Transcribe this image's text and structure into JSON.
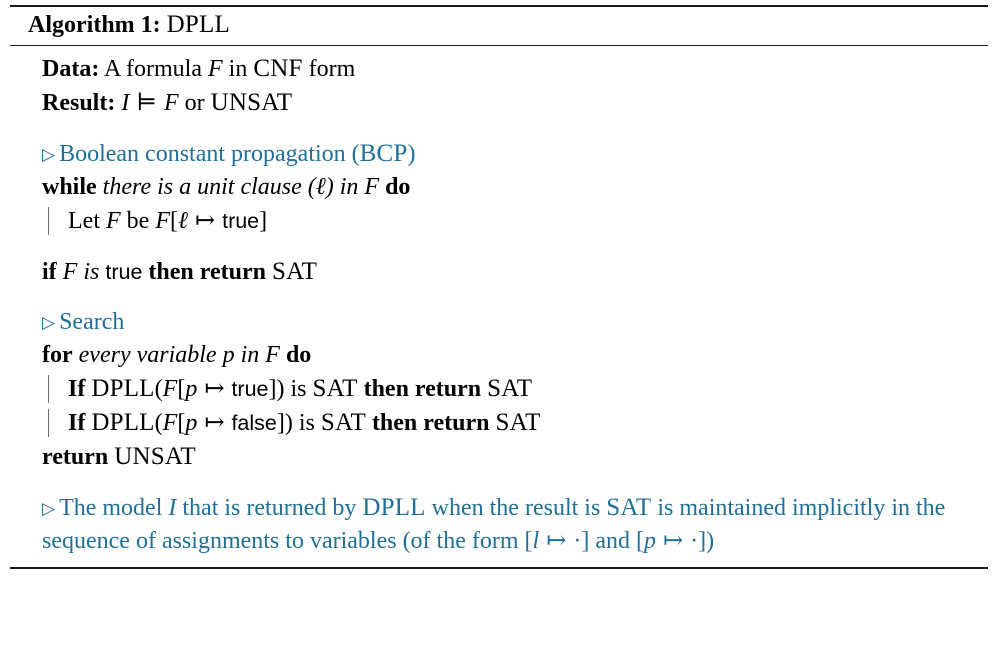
{
  "document": {
    "type": "algorithm-float",
    "caption_label": "Algorithm 1:",
    "caption_name": "DPLL",
    "comment_color": "#1f6f99",
    "text_color": "#000000",
    "rule_color": "#1a1a1a"
  },
  "io": {
    "data_label": "Data:",
    "data_text_a": "A formula",
    "data_var": "F",
    "data_text_b": "in",
    "data_format": "CNF",
    "data_text_c": "form",
    "result_label": "Result:",
    "result_var": "I",
    "result_models": "⊨",
    "result_formula": "F",
    "result_or": "or",
    "result_unsat": "UNSAT"
  },
  "bcp": {
    "comment_marker": "▷",
    "comment_text": "Boolean constant propagation (",
    "comment_abbrev": "BCP",
    "comment_close": ")",
    "while_kw": "while",
    "while_cond_a": "there is a unit clause",
    "while_cond_lit": "(ℓ)",
    "while_cond_b": "in",
    "while_cond_var": "F",
    "do_kw": "do",
    "body_let": "Let",
    "body_var1": "F",
    "body_be": "be",
    "body_var2": "F",
    "body_open": "[",
    "body_lit": "ℓ",
    "body_mapsto": "↦",
    "body_value": "true",
    "body_close": "]"
  },
  "sat_check": {
    "if_kw": "if",
    "if_var": "F",
    "if_is": "is",
    "if_value": "true",
    "then_kw": "then return",
    "result": "SAT"
  },
  "search": {
    "comment_marker": "▷",
    "comment_text": "Search",
    "for_kw": "for",
    "for_cond_a": "every variable",
    "for_var": "p",
    "for_cond_b": "in",
    "for_formula": "F",
    "do_kw": "do",
    "branches": [
      {
        "if_kw": "If",
        "call": "DPLL",
        "open_paren": "(",
        "formula": "F",
        "open_brk": "[",
        "var": "p",
        "mapsto": "↦",
        "value": "true",
        "close_brk": "]",
        "close_paren": ")",
        "is": "is",
        "status": "SAT",
        "then_kw": "then return",
        "result": "SAT"
      },
      {
        "if_kw": "If",
        "call": "DPLL",
        "open_paren": "(",
        "formula": "F",
        "open_brk": "[",
        "var": "p",
        "mapsto": "↦",
        "value": "false",
        "close_brk": "]",
        "close_paren": ")",
        "is": "is",
        "status": "SAT",
        "then_kw": "then return",
        "result": "SAT"
      }
    ],
    "return_kw": "return",
    "return_value": "UNSAT"
  },
  "note": {
    "comment_marker": "▷",
    "t1": "The model",
    "m1": "I",
    "t2": "that is returned by",
    "sc1": "DPLL",
    "t3": "when the result is",
    "sc2": "SAT",
    "t4": "is maintained implicitly in the sequence of assignments to variables (of the form",
    "f1_open": "[",
    "f1_var": "l",
    "f1_mapsto": "↦",
    "f1_dot": "·",
    "f1_close": "]",
    "t5": "and",
    "f2_open": "[",
    "f2_var": "p",
    "f2_mapsto": "↦",
    "f2_dot": "·",
    "f2_close": "]",
    "t6": ")"
  }
}
